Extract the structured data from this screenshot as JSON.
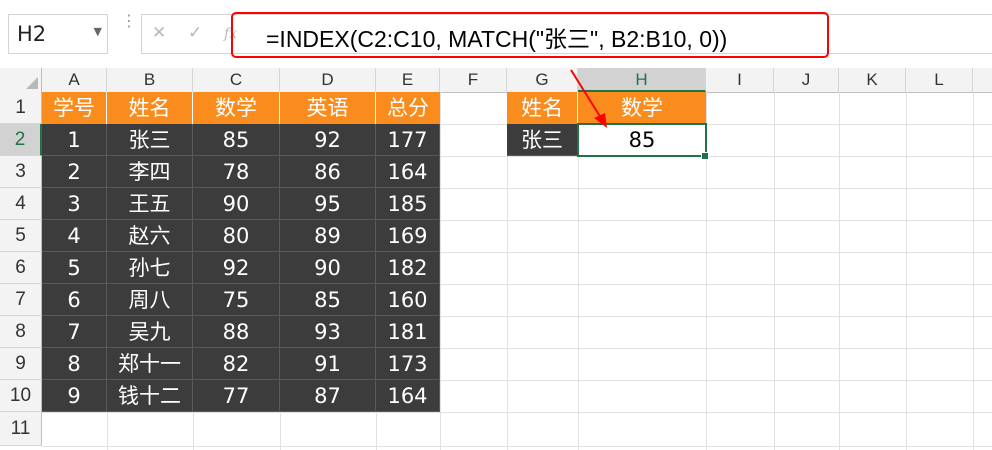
{
  "formula_bar": {
    "name_box": "H2",
    "cancel_icon": "✕",
    "enter_icon": "✓",
    "fx_label": "fx",
    "formula": "=INDEX(C2:C10, MATCH(\"张三\", B2:B10, 0))"
  },
  "columns": [
    "A",
    "B",
    "C",
    "D",
    "E",
    "F",
    "G",
    "H",
    "I",
    "J",
    "K",
    "L"
  ],
  "rows": [
    "1",
    "2",
    "3",
    "4",
    "5",
    "6",
    "7",
    "8",
    "9",
    "10",
    "11"
  ],
  "table": {
    "headers": [
      "学号",
      "姓名",
      "数学",
      "英语",
      "总分"
    ],
    "rows": [
      [
        "1",
        "张三",
        "85",
        "92",
        "177"
      ],
      [
        "2",
        "李四",
        "78",
        "86",
        "164"
      ],
      [
        "3",
        "王五",
        "90",
        "95",
        "185"
      ],
      [
        "4",
        "赵六",
        "80",
        "89",
        "169"
      ],
      [
        "5",
        "孙七",
        "92",
        "90",
        "182"
      ],
      [
        "6",
        "周八",
        "75",
        "85",
        "160"
      ],
      [
        "7",
        "吴九",
        "88",
        "93",
        "181"
      ],
      [
        "8",
        "郑十一",
        "82",
        "91",
        "173"
      ],
      [
        "9",
        "钱十二",
        "77",
        "87",
        "164"
      ]
    ]
  },
  "lookup": {
    "header_name": "姓名",
    "header_math": "数学",
    "name_value": "张三",
    "result_value": "85"
  },
  "colors": {
    "header_orange": "#fa8c1e",
    "body_dark": "#3c3c3c",
    "selection_green": "#217346",
    "annotation_red": "#ff0000"
  }
}
